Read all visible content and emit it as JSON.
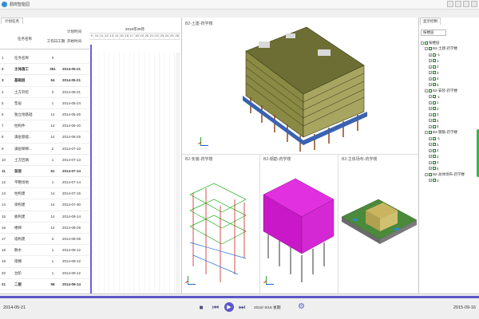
{
  "app": {
    "title": "勤岗智能园"
  },
  "left_panel": {
    "tab": "计划任务",
    "header": {
      "plan_time": "计划时间",
      "name": "任务名称",
      "duration": "工作日工期",
      "start": "开始时间"
    },
    "gantt_month": "2015年09月",
    "gantt_days": [
      "9",
      "10",
      "11",
      "12",
      "13",
      "14",
      "15",
      "16",
      "17",
      "18",
      "19",
      "20",
      "21",
      "22",
      "23",
      "24",
      "25",
      "26"
    ],
    "rows": [
      {
        "idx": "1",
        "name": "任务名称",
        "dur": "0",
        "date": "",
        "bold": false
      },
      {
        "idx": "2",
        "name": "主体施工",
        "dur": "391",
        "date": "2014-05-21",
        "bold": true
      },
      {
        "idx": "3",
        "name": "基础层",
        "dur": "54",
        "date": "2014-05-21",
        "bold": true
      },
      {
        "idx": "4",
        "name": "土方开挖",
        "dur": "2",
        "date": "2014-05-21",
        "bold": false
      },
      {
        "idx": "5",
        "name": "垫层",
        "dur": "1",
        "date": "2014-05-24",
        "bold": false
      },
      {
        "idx": "6",
        "name": "独立地基础",
        "dur": "14",
        "date": "2014-05-26",
        "bold": false
      },
      {
        "idx": "7",
        "name": "柱构件",
        "dur": "14",
        "date": "2014-06-10",
        "bold": false
      },
      {
        "idx": "8",
        "name": "满层基础...",
        "dur": "14",
        "date": "2014-06-25",
        "bold": false
      },
      {
        "idx": "9",
        "name": "满层梯梯...",
        "dur": "2",
        "date": "2014-07-10",
        "bold": false
      },
      {
        "idx": "10",
        "name": "土方回填",
        "dur": "1",
        "date": "2014-07-13",
        "bold": false
      },
      {
        "idx": "11",
        "name": "首层",
        "dur": "61",
        "date": "2014-07-14",
        "bold": true
      },
      {
        "idx": "12",
        "name": "平整场地",
        "dur": "1",
        "date": "2014-07-14",
        "bold": false
      },
      {
        "idx": "13",
        "name": "柱构建",
        "dur": "14",
        "date": "2014-07-15",
        "bold": false
      },
      {
        "idx": "14",
        "name": "梁构建",
        "dur": "14",
        "date": "2014-07-30",
        "bold": false
      },
      {
        "idx": "15",
        "name": "板构建",
        "dur": "14",
        "date": "2014-08-14",
        "bold": false
      },
      {
        "idx": "16",
        "name": "楼梯",
        "dur": "14",
        "date": "2014-08-29",
        "bold": false
      },
      {
        "idx": "17",
        "name": "墙构建",
        "dur": "3",
        "date": "2014-09-08",
        "bold": false
      },
      {
        "idx": "18",
        "name": "散水",
        "dur": "1",
        "date": "2014-09-12",
        "bold": false
      },
      {
        "idx": "19",
        "name": "雨棚",
        "dur": "1",
        "date": "2014-09-12",
        "bold": false
      },
      {
        "idx": "20",
        "name": "台阶",
        "dur": "1",
        "date": "2014-09-12",
        "bold": false
      },
      {
        "idx": "21",
        "name": "二层",
        "dur": "58",
        "date": "2014-09-14",
        "bold": true
      }
    ]
  },
  "views": {
    "main": "B2-土建-药学楼",
    "install": "B2-安装-药学楼",
    "steel": "B2-钢筋-药学楼",
    "site": "B2-主体场布-药学楼"
  },
  "right_panel": {
    "tab": "显示控制",
    "select": "按楼层",
    "tree": [
      {
        "level": 0,
        "label": "按楼层",
        "toggle": "-"
      },
      {
        "level": 1,
        "label": "B2-土建-药学楼",
        "toggle": "-"
      },
      {
        "level": 2,
        "label": "-1",
        "toggle": "+"
      },
      {
        "level": 2,
        "label": "1",
        "toggle": "+"
      },
      {
        "level": 2,
        "label": "2",
        "toggle": "+"
      },
      {
        "level": 2,
        "label": "3",
        "toggle": "+"
      },
      {
        "level": 2,
        "label": "4",
        "toggle": "+"
      },
      {
        "level": 2,
        "label": "5",
        "toggle": "+"
      },
      {
        "level": 1,
        "label": "B2-安装-药学楼",
        "toggle": "-"
      },
      {
        "level": 2,
        "label": "-1",
        "toggle": "+"
      },
      {
        "level": 2,
        "label": "1",
        "toggle": "+"
      },
      {
        "level": 2,
        "label": "2",
        "toggle": "+"
      },
      {
        "level": 2,
        "label": "3",
        "toggle": "+"
      },
      {
        "level": 2,
        "label": "4",
        "toggle": "+"
      },
      {
        "level": 2,
        "label": "5",
        "toggle": "+"
      },
      {
        "level": 1,
        "label": "B2-钢筋-药学楼",
        "toggle": "-"
      },
      {
        "level": 2,
        "label": "-1",
        "toggle": "+"
      },
      {
        "level": 2,
        "label": "1",
        "toggle": "+"
      },
      {
        "level": 2,
        "label": "2",
        "toggle": "+"
      },
      {
        "level": 2,
        "label": "3",
        "toggle": "+"
      },
      {
        "level": 2,
        "label": "4",
        "toggle": "+"
      },
      {
        "level": 2,
        "label": "5",
        "toggle": "+"
      },
      {
        "level": 1,
        "label": "B2-总体场布-药学楼",
        "toggle": "-"
      },
      {
        "level": 2,
        "label": "0",
        "toggle": "+"
      }
    ]
  },
  "bottom": {
    "start_date": "2014-05-21",
    "end_date": "2015-09-16",
    "current_date": "2015/ 9/16 星期",
    "stop_label": "■",
    "prev_label": "⏮",
    "play_label": "▶",
    "next_label": "⏭",
    "gear_label": "⚙"
  },
  "colors": {
    "accent": "#5b57c8",
    "building": "#7a7a3a",
    "steel": "#d02ad0"
  }
}
